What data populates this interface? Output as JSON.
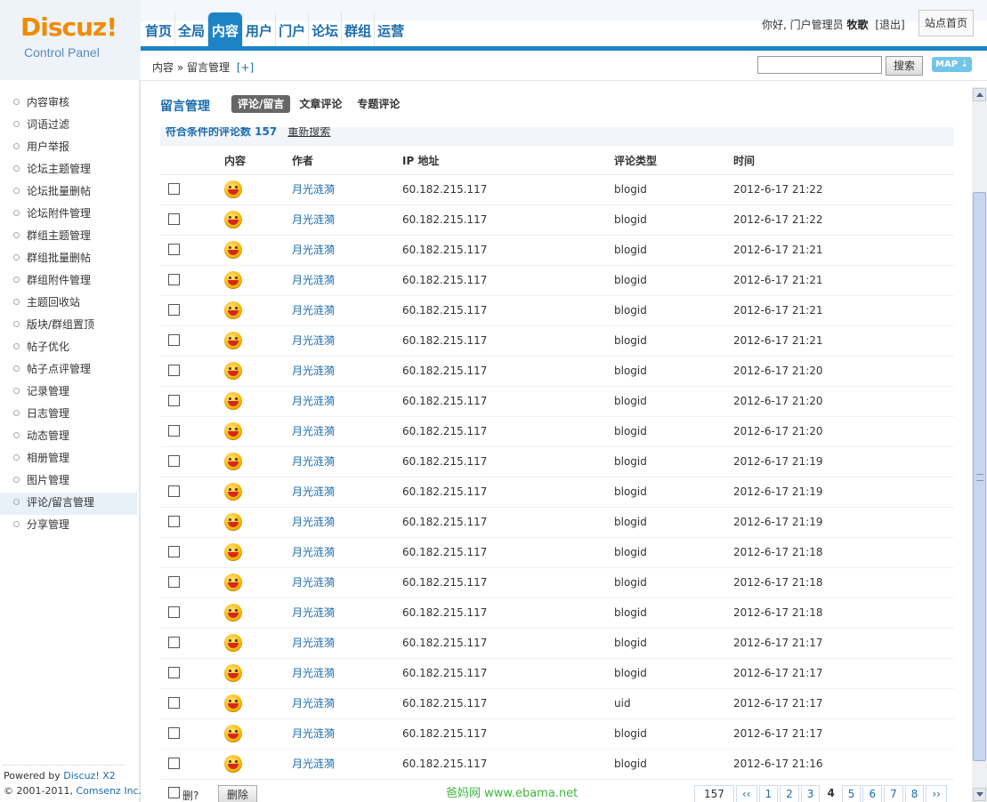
{
  "logo": {
    "brand": "Discuz!",
    "subtitle": "Control Panel"
  },
  "nav": [
    "首页",
    "全局",
    "内容",
    "用户",
    "门户",
    "论坛",
    "群组",
    "运营"
  ],
  "nav_active_index": 2,
  "user": {
    "greeting": "你好, 门户管理员",
    "name": "牧歌",
    "logout": "[退出]",
    "site_home": "站点首页"
  },
  "breadcrumb": {
    "path": "内容 » 留言管理",
    "add": "[+]"
  },
  "search": {
    "value": "",
    "button": "搜索",
    "map": "MAP ⇣"
  },
  "sidebar": {
    "items": [
      "内容审核",
      "词语过滤",
      "用户举报",
      "论坛主题管理",
      "论坛批量删帖",
      "论坛附件管理",
      "群组主题管理",
      "群组批量删帖",
      "群组附件管理",
      "主题回收站",
      "版块/群组置顶",
      "帖子优化",
      "帖子点评管理",
      "记录管理",
      "日志管理",
      "动态管理",
      "相册管理",
      "图片管理",
      "评论/留言管理",
      "分享管理"
    ],
    "active_index": 18,
    "powered_prefix": "Powered by ",
    "powered_link": "Discuz! X2",
    "copy_prefix": "© 2001-2011, ",
    "copy_link": "Comsenz Inc."
  },
  "main": {
    "title": "留言管理",
    "tabs": [
      "评论/留言",
      "文章评论",
      "专题评论"
    ],
    "active_tab": 0,
    "result_text": "符合条件的评论数 157",
    "re_search": "重新搜索",
    "columns": {
      "content": "内容",
      "author": "作者",
      "ip": "IP 地址",
      "type": "评论类型",
      "time": "时间"
    },
    "rows": [
      {
        "author": "月光涟漪",
        "ip": "60.182.215.117",
        "type": "blogid",
        "time": "2012-6-17 21:22"
      },
      {
        "author": "月光涟漪",
        "ip": "60.182.215.117",
        "type": "blogid",
        "time": "2012-6-17 21:22"
      },
      {
        "author": "月光涟漪",
        "ip": "60.182.215.117",
        "type": "blogid",
        "time": "2012-6-17 21:21"
      },
      {
        "author": "月光涟漪",
        "ip": "60.182.215.117",
        "type": "blogid",
        "time": "2012-6-17 21:21"
      },
      {
        "author": "月光涟漪",
        "ip": "60.182.215.117",
        "type": "blogid",
        "time": "2012-6-17 21:21"
      },
      {
        "author": "月光涟漪",
        "ip": "60.182.215.117",
        "type": "blogid",
        "time": "2012-6-17 21:21"
      },
      {
        "author": "月光涟漪",
        "ip": "60.182.215.117",
        "type": "blogid",
        "time": "2012-6-17 21:20"
      },
      {
        "author": "月光涟漪",
        "ip": "60.182.215.117",
        "type": "blogid",
        "time": "2012-6-17 21:20"
      },
      {
        "author": "月光涟漪",
        "ip": "60.182.215.117",
        "type": "blogid",
        "time": "2012-6-17 21:20"
      },
      {
        "author": "月光涟漪",
        "ip": "60.182.215.117",
        "type": "blogid",
        "time": "2012-6-17 21:19"
      },
      {
        "author": "月光涟漪",
        "ip": "60.182.215.117",
        "type": "blogid",
        "time": "2012-6-17 21:19"
      },
      {
        "author": "月光涟漪",
        "ip": "60.182.215.117",
        "type": "blogid",
        "time": "2012-6-17 21:19"
      },
      {
        "author": "月光涟漪",
        "ip": "60.182.215.117",
        "type": "blogid",
        "time": "2012-6-17 21:18"
      },
      {
        "author": "月光涟漪",
        "ip": "60.182.215.117",
        "type": "blogid",
        "time": "2012-6-17 21:18"
      },
      {
        "author": "月光涟漪",
        "ip": "60.182.215.117",
        "type": "blogid",
        "time": "2012-6-17 21:18"
      },
      {
        "author": "月光涟漪",
        "ip": "60.182.215.117",
        "type": "blogid",
        "time": "2012-6-17 21:17"
      },
      {
        "author": "月光涟漪",
        "ip": "60.182.215.117",
        "type": "blogid",
        "time": "2012-6-17 21:17"
      },
      {
        "author": "月光涟漪",
        "ip": "60.182.215.117",
        "type": "uid",
        "time": "2012-6-17 21:17"
      },
      {
        "author": "月光涟漪",
        "ip": "60.182.215.117",
        "type": "blogid",
        "time": "2012-6-17 21:17"
      },
      {
        "author": "月光涟漪",
        "ip": "60.182.215.117",
        "type": "blogid",
        "time": "2012-6-17 21:16"
      }
    ],
    "footer": {
      "delete_label": "删?",
      "delete_button": "删除",
      "watermark": "爸妈网 www.ebama.net",
      "pager": [
        "157",
        "‹‹",
        "1",
        "2",
        "3",
        "4",
        "5",
        "6",
        "7",
        "8",
        "››"
      ],
      "current_page": "4"
    }
  },
  "colors": {
    "accent": "#1c84c6",
    "logo": "#f08c00",
    "watermark": "#3db73d"
  }
}
